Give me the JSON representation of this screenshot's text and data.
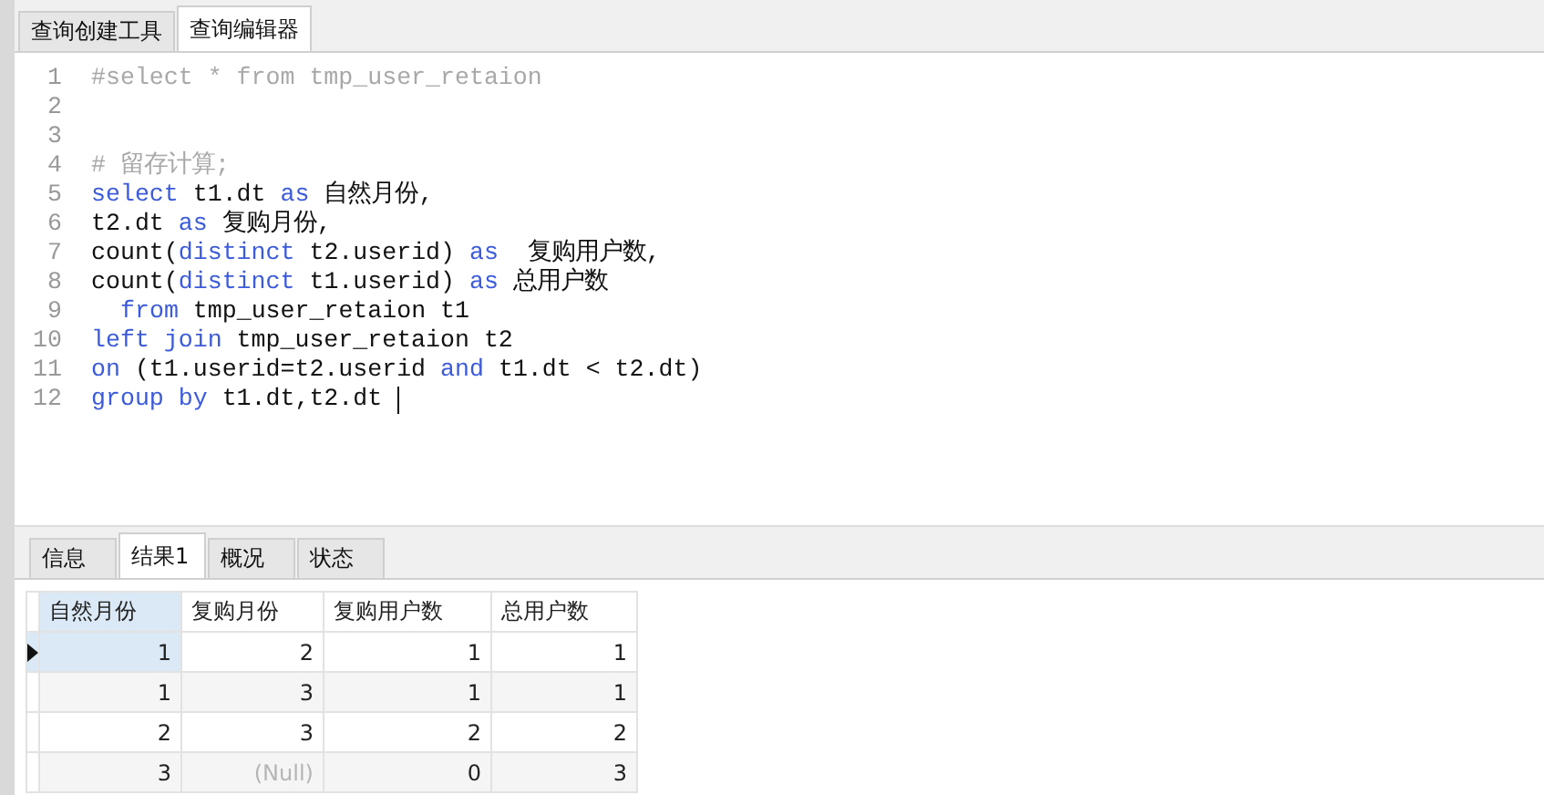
{
  "editor_tabs": [
    {
      "label": "查询创建工具",
      "selected": false
    },
    {
      "label": "查询编辑器",
      "selected": true
    }
  ],
  "code_lines": [
    {
      "number": "1",
      "caret": false,
      "indented": false,
      "tokens": [
        {
          "kind": "comment",
          "text": "#select * from tmp_user_retaion"
        }
      ]
    },
    {
      "number": "2",
      "caret": false
    },
    {
      "number": "3",
      "caret": false
    },
    {
      "number": "4",
      "caret": false,
      "indented": false,
      "tokens": [
        {
          "kind": "comment",
          "text": "# 留存计算;"
        }
      ]
    },
    {
      "number": "5",
      "caret": false,
      "indented": false,
      "tokens": [
        {
          "kind": "keyword",
          "text": "select"
        },
        {
          "kind": "plain",
          "text": " t1.dt "
        },
        {
          "kind": "keyword",
          "text": "as"
        },
        {
          "kind": "plain",
          "text": " 自然月份,"
        }
      ]
    },
    {
      "number": "6",
      "caret": false,
      "indented": false,
      "tokens": [
        {
          "kind": "plain",
          "text": "t2.dt "
        },
        {
          "kind": "keyword",
          "text": "as"
        },
        {
          "kind": "plain",
          "text": " 复购月份,"
        }
      ]
    },
    {
      "number": "7",
      "caret": false,
      "indented": false,
      "tokens": [
        {
          "kind": "plain",
          "text": "count("
        },
        {
          "kind": "keyword",
          "text": "distinct"
        },
        {
          "kind": "plain",
          "text": " t2.userid) "
        },
        {
          "kind": "keyword",
          "text": "as"
        },
        {
          "kind": "plain",
          "text": "  复购用户数,"
        }
      ]
    },
    {
      "number": "8",
      "caret": false,
      "indented": false,
      "tokens": [
        {
          "kind": "plain",
          "text": "count("
        },
        {
          "kind": "keyword",
          "text": "distinct"
        },
        {
          "kind": "plain",
          "text": " t1.userid) "
        },
        {
          "kind": "keyword",
          "text": "as"
        },
        {
          "kind": "plain",
          "text": " 总用户数"
        }
      ]
    },
    {
      "number": "9",
      "caret": false,
      "indented": true,
      "tokens": [
        {
          "kind": "keyword",
          "text": "from"
        },
        {
          "kind": "plain",
          "text": " tmp_user_retaion t1"
        }
      ]
    },
    {
      "number": "10",
      "caret": false,
      "indented": false,
      "tokens": [
        {
          "kind": "keyword",
          "text": "left join"
        },
        {
          "kind": "plain",
          "text": " tmp_user_retaion t2"
        }
      ]
    },
    {
      "number": "11",
      "caret": false,
      "indented": false,
      "tokens": [
        {
          "kind": "keyword",
          "text": "on"
        },
        {
          "kind": "plain",
          "text": " (t1.userid=t2.userid "
        },
        {
          "kind": "keyword",
          "text": "and"
        },
        {
          "kind": "plain",
          "text": " t1.dt < t2.dt)"
        }
      ]
    },
    {
      "number": "12",
      "caret": true,
      "indented": false,
      "tokens": [
        {
          "kind": "keyword",
          "text": "group by"
        },
        {
          "kind": "plain",
          "text": " t1.dt,t2.dt"
        }
      ]
    }
  ],
  "result_tabs": [
    {
      "label": "信息",
      "selected": false
    },
    {
      "label": "结果1",
      "selected": true
    },
    {
      "label": "概况",
      "selected": false
    },
    {
      "label": "状态",
      "selected": false
    }
  ],
  "table": {
    "columns": [
      {
        "label": "自然月份",
        "selected": true
      },
      {
        "label": "复购月份",
        "selected": false
      },
      {
        "label": "复购用户数",
        "selected": false
      },
      {
        "label": "总用户数",
        "selected": false
      }
    ],
    "rows": [
      {
        "selected": true,
        "cells": [
          {
            "kind": "value",
            "text": "1"
          },
          {
            "kind": "value",
            "text": "2"
          },
          {
            "kind": "value",
            "text": "1"
          },
          {
            "kind": "value",
            "text": "1"
          }
        ]
      },
      {
        "selected": false,
        "cells": [
          {
            "kind": "value",
            "text": "1"
          },
          {
            "kind": "value",
            "text": "3"
          },
          {
            "kind": "value",
            "text": "1"
          },
          {
            "kind": "value",
            "text": "1"
          }
        ]
      },
      {
        "selected": false,
        "cells": [
          {
            "kind": "value",
            "text": "2"
          },
          {
            "kind": "value",
            "text": "3"
          },
          {
            "kind": "value",
            "text": "2"
          },
          {
            "kind": "value",
            "text": "2"
          }
        ]
      },
      {
        "selected": false,
        "cells": [
          {
            "kind": "value",
            "text": "3"
          },
          {
            "kind": "null",
            "text": "(Null)"
          },
          {
            "kind": "value",
            "text": "0"
          },
          {
            "kind": "value",
            "text": "3"
          }
        ]
      }
    ]
  }
}
